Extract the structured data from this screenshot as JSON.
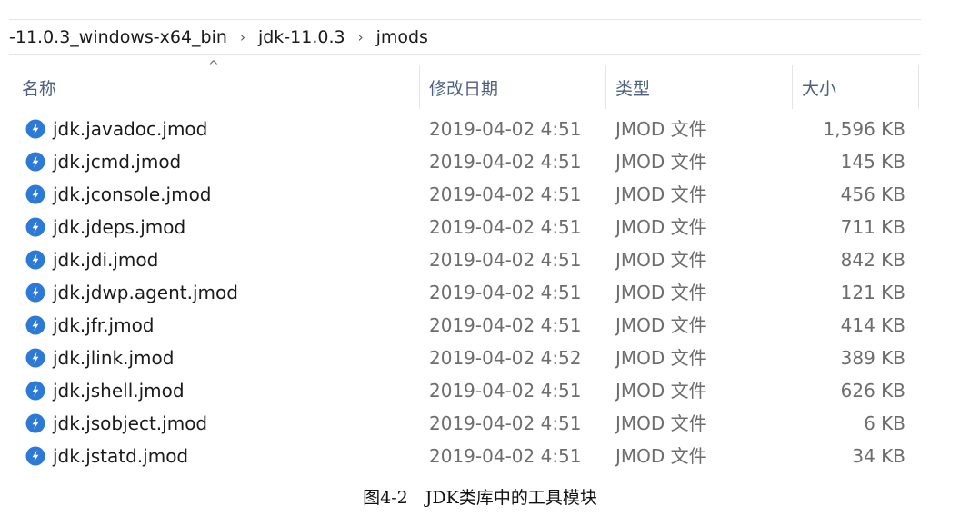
{
  "breadcrumb": [
    "-11.0.3_windows-x64_bin",
    "jdk-11.0.3",
    "jmods"
  ],
  "breadcrumb_separator": "›",
  "columns": {
    "name": "名称",
    "modified": "修改日期",
    "type": "类型",
    "size": "大小"
  },
  "sort_indicator": "^",
  "file_icon": "jmod-file-icon",
  "accent_color": "#2d7ad6",
  "files": [
    {
      "name": "jdk.javadoc.jmod",
      "modified": "2019-04-02 4:51",
      "type": "JMOD 文件",
      "size": "1,596 KB"
    },
    {
      "name": "jdk.jcmd.jmod",
      "modified": "2019-04-02 4:51",
      "type": "JMOD 文件",
      "size": "145 KB"
    },
    {
      "name": "jdk.jconsole.jmod",
      "modified": "2019-04-02 4:51",
      "type": "JMOD 文件",
      "size": "456 KB"
    },
    {
      "name": "jdk.jdeps.jmod",
      "modified": "2019-04-02 4:51",
      "type": "JMOD 文件",
      "size": "711 KB"
    },
    {
      "name": "jdk.jdi.jmod",
      "modified": "2019-04-02 4:51",
      "type": "JMOD 文件",
      "size": "842 KB"
    },
    {
      "name": "jdk.jdwp.agent.jmod",
      "modified": "2019-04-02 4:51",
      "type": "JMOD 文件",
      "size": "121 KB"
    },
    {
      "name": "jdk.jfr.jmod",
      "modified": "2019-04-02 4:51",
      "type": "JMOD 文件",
      "size": "414 KB"
    },
    {
      "name": "jdk.jlink.jmod",
      "modified": "2019-04-02 4:52",
      "type": "JMOD 文件",
      "size": "389 KB"
    },
    {
      "name": "jdk.jshell.jmod",
      "modified": "2019-04-02 4:51",
      "type": "JMOD 文件",
      "size": "626 KB"
    },
    {
      "name": "jdk.jsobject.jmod",
      "modified": "2019-04-02 4:51",
      "type": "JMOD 文件",
      "size": "6 KB"
    },
    {
      "name": "jdk.jstatd.jmod",
      "modified": "2019-04-02 4:51",
      "type": "JMOD 文件",
      "size": "34 KB"
    }
  ],
  "caption": "图4-2　JDK类库中的工具模块"
}
